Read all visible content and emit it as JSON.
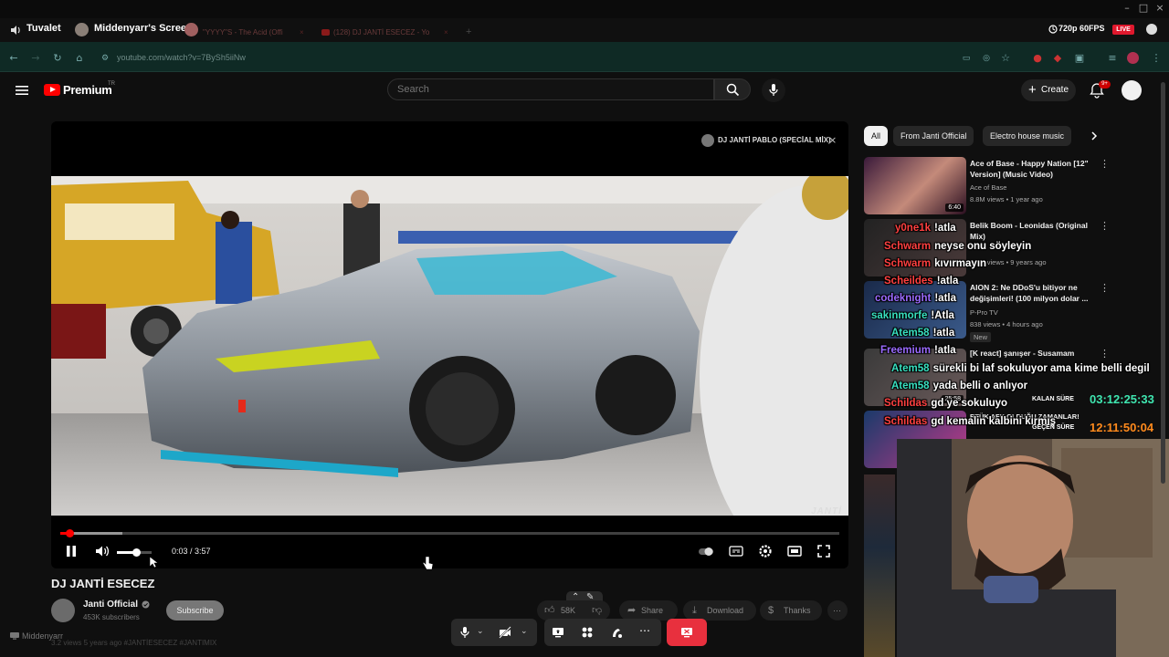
{
  "sharebar": {
    "audio_label": "Tuvalet",
    "screen_label": "Middenyarr's Screen",
    "tab1": "\"YYYY\"S - The Acid (Offi",
    "tab2": "(128) DJ JANTİ ESECEZ - Yo",
    "quality": "720p 60FPS",
    "live": "LIVE"
  },
  "browser": {
    "url": "youtube.com/watch?v=7BySh5iiNw"
  },
  "youtube": {
    "brand": "Premium",
    "region": "TR",
    "search_placeholder": "Search",
    "create_label": "Create",
    "notif_count": "9+"
  },
  "player": {
    "overlay_title": "DJ JANTİ PABLO (SPECİAL MİX)",
    "watermark": "JANTİ",
    "current_time": "0:03",
    "duration": "3:57",
    "time_display": "0:03 / 3:57",
    "progress_played_fraction": 0.012,
    "progress_buffered_fraction": 0.08,
    "volume_fraction": 0.55
  },
  "video": {
    "title": "DJ JANTİ ESECEZ",
    "channel": "Janti Official",
    "subscribers": "453K subscribers",
    "subscribe_label": "Subscribe",
    "likes": "58K",
    "share_label": "Share",
    "download_label": "Download",
    "thanks_label": "Thanks",
    "views_line": "3.2 views 5 years ago  #JANTİESECEZ  #JANTIMIX"
  },
  "chips": [
    "All",
    "From Janti Official",
    "Electro house music"
  ],
  "recommendations": [
    {
      "title": "Ace of Base - Happy Nation [12\" Version] (Music Video)",
      "channel": "Ace of Base",
      "meta": "8.8M views • 1 year ago",
      "duration": "6:40"
    },
    {
      "title": "Belik Boom - Leonidas (Original Mix)",
      "channel": "",
      "meta": "1.1M views • 9 years ago",
      "duration": ""
    },
    {
      "title": "AION 2: Ne DDoS'u bitiyor ne değişimleri! (100 milyon dolar ...",
      "channel": "P-Pro TV",
      "meta": "838 views • 4 hours ago",
      "badge": "New",
      "duration": ""
    },
    {
      "title": "[K react] şanışer - Susamam",
      "channel": "",
      "meta": "",
      "duration": "25:58"
    },
    {
      "title": "RTÜK AFK OLDUĞU ZAMANLAR!",
      "channel": "",
      "meta": "",
      "duration": ""
    }
  ],
  "chat": [
    {
      "user": "y0ne1k",
      "msg": "!atla",
      "color": "red"
    },
    {
      "user": "Schwarm",
      "msg": "neyse onu söyleyin",
      "color": "red"
    },
    {
      "user": "Schwarm",
      "msg": "kıvırmayın",
      "color": "red"
    },
    {
      "user": "Scheildes",
      "msg": "!atla",
      "color": "red"
    },
    {
      "user": "codeknight",
      "msg": "!atla",
      "color": "purple"
    },
    {
      "user": "sakinmorfe",
      "msg": "!Atla",
      "color": "teal"
    },
    {
      "user": "Atem58",
      "msg": "!atla",
      "color": "teal"
    },
    {
      "user": "Freemium",
      "msg": "!atla",
      "color": "purple"
    },
    {
      "user": "Atem58",
      "msg": "sürekli bi laf sokuluyor ama kime belli degil",
      "color": "teal"
    },
    {
      "user": "Atem58",
      "msg": "yada belli o anlıyor",
      "color": "teal"
    },
    {
      "user": "Schildas",
      "msg": "gd ye sokuluyo",
      "color": "red"
    },
    {
      "user": "Schildas",
      "msg": "gd kemalin kalbini kırmış",
      "color": "red"
    }
  ],
  "timers": {
    "remaining_label": "KALAN SÜRE",
    "remaining_value": "03:12:25:33",
    "elapsed_label": "GEÇEN SÜRE",
    "elapsed_value": "12:11:50:04"
  },
  "sharer": "Middenyarr",
  "colors": {
    "yt_red": "#ff0000",
    "chat_red": "#ff4040",
    "chat_teal": "#38e0c0",
    "timer_teal": "#3fe6b0",
    "timer_orange": "#ff8a1c",
    "stop_red": "#e8303e",
    "url_bar": "#0f2a25"
  }
}
